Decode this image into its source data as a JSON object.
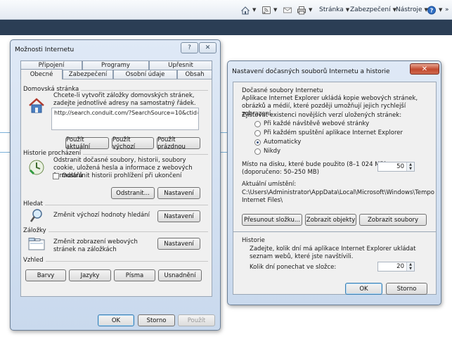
{
  "browser_toolbar": {
    "page_menu": "Stránka",
    "security_menu": "Zabezpečení",
    "tools_menu": "Nástroje",
    "more": "»"
  },
  "internet_options": {
    "title": "Možnosti Internetu",
    "help_button": "?",
    "close_button": "✕",
    "tabs_back": [
      "Připojení",
      "Programy",
      "Upřesnit"
    ],
    "tabs_front": [
      "Obecné",
      "Zabezpečení",
      "Osobní údaje",
      "Obsah"
    ],
    "home": {
      "label": "Domovská stránka",
      "description": "Chcete-li vytvořit záložky domovských stránek, zadejte jednotlivé adresy na samostatný řádek.",
      "url": "http://search.conduit.com/?SearchSource=10&ctid=C",
      "use_current": "Použít aktuální",
      "use_default": "Použít výchozí",
      "use_blank": "Použít prázdnou"
    },
    "history": {
      "label": "Historie procházení",
      "description": "Odstranit dočasné soubory, historii, soubory cookie, uložená hesla a informace z webových formulářů",
      "delete_on_exit": "Odstranit historii prohlížení při ukončení",
      "delete_button": "Odstranit...",
      "settings_button": "Nastavení"
    },
    "search": {
      "label": "Hledat",
      "description": "Změnit výchozí hodnoty hledání",
      "settings_button": "Nastavení"
    },
    "tabs": {
      "label": "Záložky",
      "description": "Změnit zobrazení webových stránek na záložkách",
      "settings_button": "Nastavení"
    },
    "appearance": {
      "label": "Vzhled",
      "colors": "Barvy",
      "languages": "Jazyky",
      "fonts": "Písma",
      "accessibility": "Usnadnění"
    },
    "ok": "OK",
    "cancel": "Storno",
    "apply": "Použít"
  },
  "temp_files": {
    "title": "Nastavení dočasných souborů Internetu a historie",
    "close_button": "✕",
    "section_label": "Dočasné soubory Internetu",
    "description": "Aplikace Internet Explorer ukládá kopie webových stránek, obrázků a médií, které později umožňují jejich rychlejší zobrazení.",
    "check_label": "Zjišťovat existenci novějších verzí uložených stránek:",
    "options": [
      "Při každé návštěvě webové stránky",
      "Při každém spuštění aplikace Internet Explorer",
      "Automaticky",
      "Nikdy"
    ],
    "selected_option": 2,
    "disk_label": "Místo na disku, které bude použito (8–1 024 MB):",
    "disk_recommended": "(doporučeno: 50–250 MB)",
    "disk_value": "50",
    "location_label": "Aktuální umístění:",
    "location_path": "C:\\Users\\Administrator\\AppData\\Local\\Microsoft\\Windows\\Tempo Internet Files\\",
    "move_folder": "Přesunout složku...",
    "view_objects": "Zobrazit objekty",
    "view_files": "Zobrazit soubory",
    "history_label": "Historie",
    "history_description": "Zadejte, kolik dní má aplikace Internet Explorer ukládat seznam webů, které jste navštívili.",
    "days_label": "Kolik dní ponechat ve složce:",
    "days_value": "20",
    "ok": "OK",
    "cancel": "Storno"
  }
}
